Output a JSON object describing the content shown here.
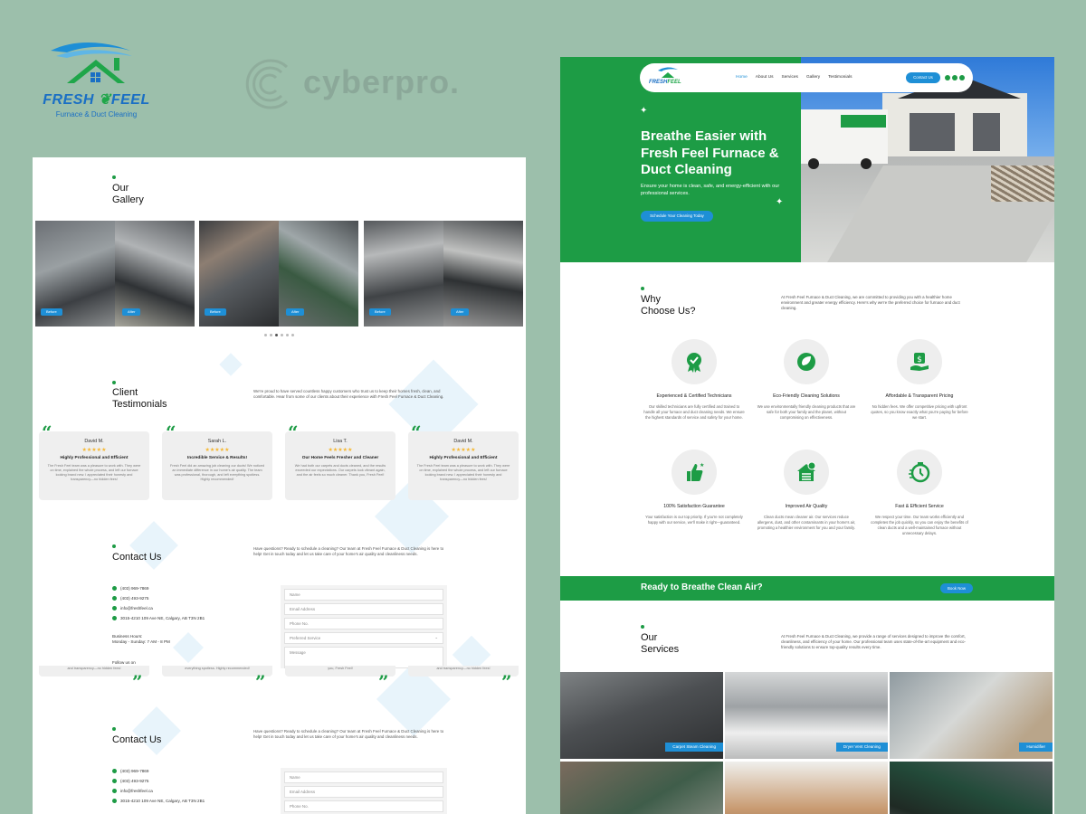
{
  "brand": {
    "name_a": "FRESH",
    "name_b": "FEEL",
    "tagline": "Furnace & Duct Cleaning",
    "partner": "cyberpro."
  },
  "colors": {
    "green": "#1d9c45",
    "blue": "#1e8fd6",
    "bg": "#9cbfab"
  },
  "gallery": {
    "title": "Our\nGallery",
    "labels": [
      "Before",
      "After",
      "Before",
      "After",
      "Before",
      "After"
    ]
  },
  "testimonials": {
    "title": "Client\nTestimonials",
    "intro": "We're proud to have served countless happy customers who trust us to keep their homes fresh, clean, and comfortable. Hear from some of our clients about their experience with Fresh Feel Furnace & Duct Cleaning.",
    "items": [
      {
        "name": "David M.",
        "stars": "★★★★★",
        "title": "Highly Professional and Efficient",
        "body": "The Fresh Feel team was a pleasure to work with. They were on time, explained the whole process, and left our furnace looking brand new. I appreciated their honesty and transparency—no hidden fees!"
      },
      {
        "name": "Sarah L.",
        "stars": "★★★★★",
        "title": "Incredible Service & Results!",
        "body": "Fresh Feel did an amazing job cleaning our ducts! We noticed an immediate difference in our home's air quality. The team was professional, thorough, and left everything spotless. Highly recommended!"
      },
      {
        "name": "Lisa T.",
        "stars": "★★★★★",
        "title": "Our Home Feels Fresher and Cleaner",
        "body": "We had both our carpets and ducts cleaned, and the results exceeded our expectations. Our carpets look vibrant again, and the air feels so much cleaner. Thank you, Fresh Feel!"
      },
      {
        "name": "David M.",
        "stars": "★★★★★",
        "title": "Highly Professional and Efficient",
        "body": "The Fresh Feel team was a pleasure to work with. They were on time, explained the whole process, and left our furnace looking brand new. I appreciated their honesty and transparency—no hidden fees!"
      }
    ],
    "ghost": [
      "and transparency—no hidden fees!",
      "everything spotless. Highly recommended!",
      "you, Fresh Feel!",
      "and transparency—no hidden fees!"
    ]
  },
  "contact": {
    "title": "Contact Us",
    "intro": "Have questions? Ready to schedule a cleaning? Our team at Fresh Feel Furnace & Duct Cleaning is here to help! Get in touch today and let us take care of your home's air quality and cleanliness needs.",
    "phone1": "(403) 969-7869",
    "phone2": "(403) 493-9275",
    "email": "info@freshfeel.ca",
    "address": "3015-4210 109 Ave NE, Calgary, AB T3N 2B1",
    "hours_label": "Business Hours:",
    "hours": "Monday - Sunday: 7 AM - 8 PM",
    "follow": "Follow us on",
    "fields": [
      "Name",
      "Email Address",
      "Phone No.",
      "Preferred Service",
      "Message"
    ]
  },
  "nav": {
    "items": [
      "Home",
      "About Us",
      "Services",
      "Gallery",
      "Testimonials"
    ],
    "cta": "Contact Us"
  },
  "hero": {
    "title": "Breathe Easier with Fresh Feel Furnace & Duct Cleaning",
    "subtitle": "Ensure your home is clean, safe, and energy-efficient with our professional services.",
    "cta": "Schedule Your Cleaning Today"
  },
  "why": {
    "title": "Why\nChoose Us?",
    "intro": "At Fresh Feel Furnace & Duct Cleaning, we are committed to providing you with a healthier home environment and greater energy efficiency. Here's why we're the preferred choice for furnace and duct cleaning.",
    "items": [
      {
        "icon": "certificate-icon",
        "title": "Experienced & Certified Technicians",
        "body": "Our skilled technicians are fully certified and trained to handle all your furnace and duct cleaning needs. We ensure the highest standards of service and safety for your home."
      },
      {
        "icon": "eco-leaf-icon",
        "title": "Eco-Friendly Cleaning Solutions",
        "body": "We use environmentally friendly cleaning products that are safe for both your family and the planet, without compromising on effectiveness."
      },
      {
        "icon": "dollar-hand-icon",
        "title": "Affordable & Transparent Pricing",
        "body": "No hidden fees. We offer competitive pricing with upfront quotes, so you know exactly what you're paying for before we start."
      },
      {
        "icon": "thumbs-up-icon",
        "title": "100% Satisfaction Guarantee",
        "body": "Your satisfaction is our top priority. If you're not completely happy with our service, we'll make it right—guaranteed."
      },
      {
        "icon": "house-air-icon",
        "title": "Improved Air Quality",
        "body": "Clean ducts mean cleaner air. Our services reduce allergens, dust, and other contaminants in your home's air, promoting a healthier environment for you and your family."
      },
      {
        "icon": "stopwatch-icon",
        "title": "Fast & Efficient Service",
        "body": "We respect your time. Our team works efficiently and completes the job quickly, so you can enjoy the benefits of clean ducts and a well-maintained furnace without unnecessary delays."
      }
    ]
  },
  "cta_band": {
    "title": "Ready to Breathe Clean Air?",
    "button": "Book Now"
  },
  "services": {
    "title": "Our\nServices",
    "intro": "At Fresh Feel Furnace & Duct Cleaning, we provide a range of services designed to improve the comfort, cleanliness, and efficiency of your home. Our professional team uses state-of-the-art equipment and eco-friendly solutions to ensure top-quality results every time.",
    "items": [
      "Carpet Steam Cleaning",
      "Dryer Vent Cleaning",
      "Humidifier"
    ]
  }
}
